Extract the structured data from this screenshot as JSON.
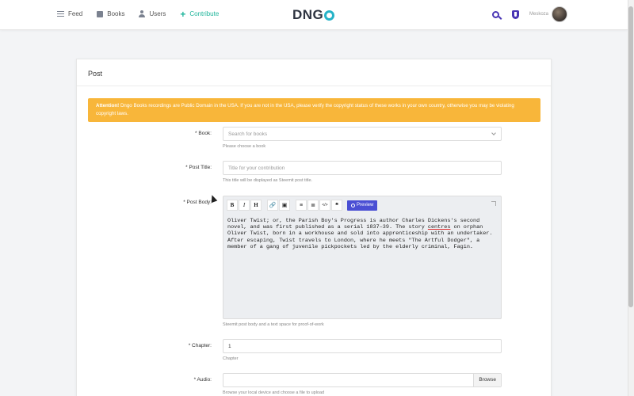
{
  "header": {
    "nav": [
      {
        "label": "Feed",
        "icon": "list-icon"
      },
      {
        "label": "Books",
        "icon": "book-icon"
      },
      {
        "label": "Users",
        "icon": "user-icon"
      },
      {
        "label": "Contribute",
        "icon": "plus-icon"
      }
    ],
    "logo_text": "DNG",
    "username": "Meskoza",
    "accent_color": "#4a36b5",
    "contribute_color": "#1fb59b"
  },
  "card": {
    "title": "Post",
    "alert_strong": "Attention!",
    "alert_text": " Dngo Books recordings are Public Domain in the USA. If you are not in the USA, please verify the copyright status of these works in your own country, otherwise you may be violating copyright laws.",
    "book": {
      "label": "* Book:",
      "placeholder": "Search for books",
      "help": "Please choose a book"
    },
    "post_title": {
      "label": "* Post Title:",
      "placeholder": "Title for your contribution",
      "help": "This title will be displayed as Steemit post title."
    },
    "post_body": {
      "label": "* Post Body:",
      "toolbar": [
        "B",
        "I",
        "H",
        "link",
        "image",
        "bullet-list",
        "numbered-list",
        "code",
        "quote"
      ],
      "preview_label": "Preview",
      "text_before": "Oliver Twist; or, the Parish Boy's Progress is author Charles Dickens's second novel, and was first published as a serial 1837–39. The story ",
      "text_underlined": "centres",
      "text_after": " on orphan Oliver Twist, born in a workhouse and sold into apprenticeship with an undertaker. After escaping, Twist travels to London, where he meets \"The Artful Dodger\", a member of a gang of juvenile pickpockets led by the elderly criminal, Fagin.",
      "help": "Steemit post body and a text space for proof-of-work"
    },
    "chapter": {
      "label": "* Chapter:",
      "value": "1",
      "help": "Chapter"
    },
    "audio": {
      "label": "* Audio:",
      "browse_label": "Browse",
      "help": "Browse your local device and choose a file to upload"
    },
    "alert_color": "#f8b63a"
  }
}
